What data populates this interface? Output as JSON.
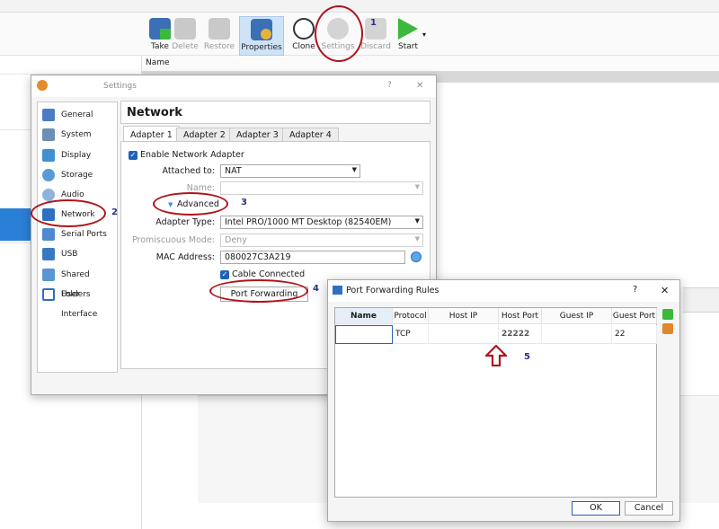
{
  "main_window": {
    "toolbar": {
      "take": "Take",
      "delete": "Delete",
      "restore": "Restore",
      "properties": "Properties",
      "clone": "Clone",
      "settings": "Settings",
      "discard": "Discard",
      "start": "Start"
    },
    "list_header": "Name"
  },
  "annotations": [
    "1",
    "2",
    "3",
    "4",
    "5"
  ],
  "settings_dialog": {
    "title": "Settings",
    "help": "?",
    "close": "✕",
    "sidebar": [
      "General",
      "System",
      "Display",
      "Storage",
      "Audio",
      "Network",
      "Serial Ports",
      "USB",
      "Shared Folders",
      "User Interface"
    ],
    "page_title": "Network",
    "tabs": [
      "Adapter 1",
      "Adapter 2",
      "Adapter 3",
      "Adapter 4"
    ],
    "enable_label": "Enable Network Adapter",
    "attached_label": "Attached to:",
    "attached_value": "NAT",
    "name_label": "Name:",
    "advanced_label": "Advanced",
    "adapter_type_label": "Adapter Type:",
    "adapter_type_value": "Intel PRO/1000 MT Desktop (82540EM)",
    "promiscuous_label": "Promiscuous Mode:",
    "promiscuous_value": "Deny",
    "mac_label": "MAC Address:",
    "mac_value": "080027C3A219",
    "cable_label": "Cable Connected",
    "port_forwarding_button": "Port Forwarding"
  },
  "port_forwarding_dialog": {
    "title": "Port Forwarding Rules",
    "help": "?",
    "close": "✕",
    "columns": [
      "Name",
      "Protocol",
      "Host IP",
      "Host Port",
      "Guest IP",
      "Guest Port"
    ],
    "rows": [
      {
        "name": "",
        "protocol": "TCP",
        "host_ip": "",
        "host_port": "22222",
        "guest_ip": "",
        "guest_port": "22"
      }
    ],
    "ok": "OK",
    "cancel": "Cancel"
  },
  "colors": {
    "annotation_red": "#b0141c",
    "annotation_number": "#27328a",
    "selection_blue": "#2a7fd6",
    "checkbox_blue": "#1f62b8"
  }
}
